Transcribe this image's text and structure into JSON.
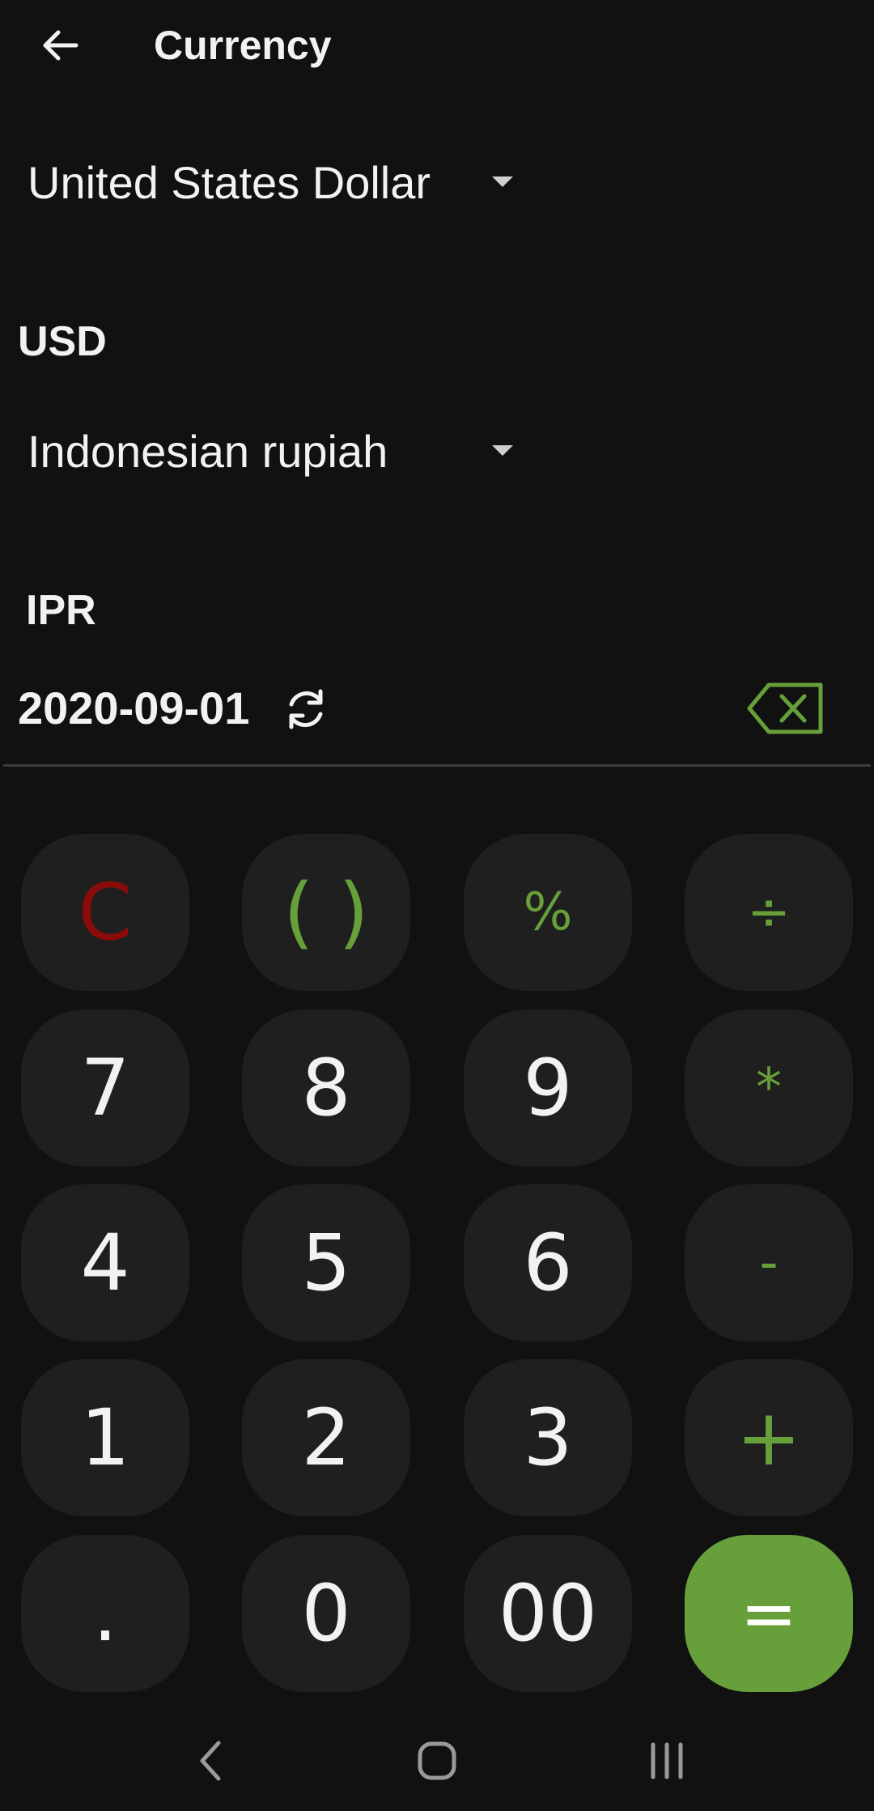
{
  "appbar": {
    "title": "Currency",
    "back_icon": "arrow-left-icon"
  },
  "from_currency": {
    "selected": "United States Dollar",
    "code": "USD"
  },
  "to_currency": {
    "selected": "Indonesian rupiah",
    "code": "IPR"
  },
  "rates": {
    "date": "2020-09-01",
    "refresh_icon": "refresh-icon",
    "backspace_icon": "backspace-icon"
  },
  "keypad": {
    "clear": "C",
    "parens": "( )",
    "percent": "%",
    "divide": "÷",
    "seven": "7",
    "eight": "8",
    "nine": "9",
    "multiply": "*",
    "four": "4",
    "five": "5",
    "six": "6",
    "minus": "-",
    "one": "1",
    "two": "2",
    "three": "3",
    "plus": "+",
    "dot": ".",
    "zero": "0",
    "double_zero": "00",
    "equals": "="
  },
  "colors": {
    "background": "#111111",
    "key": "#1f1f1f",
    "accent": "#67a03a",
    "clear": "#8b0b0b"
  },
  "navbar": {
    "back_icon": "nav-back-icon",
    "home_icon": "nav-home-icon",
    "recents_icon": "nav-recents-icon"
  }
}
